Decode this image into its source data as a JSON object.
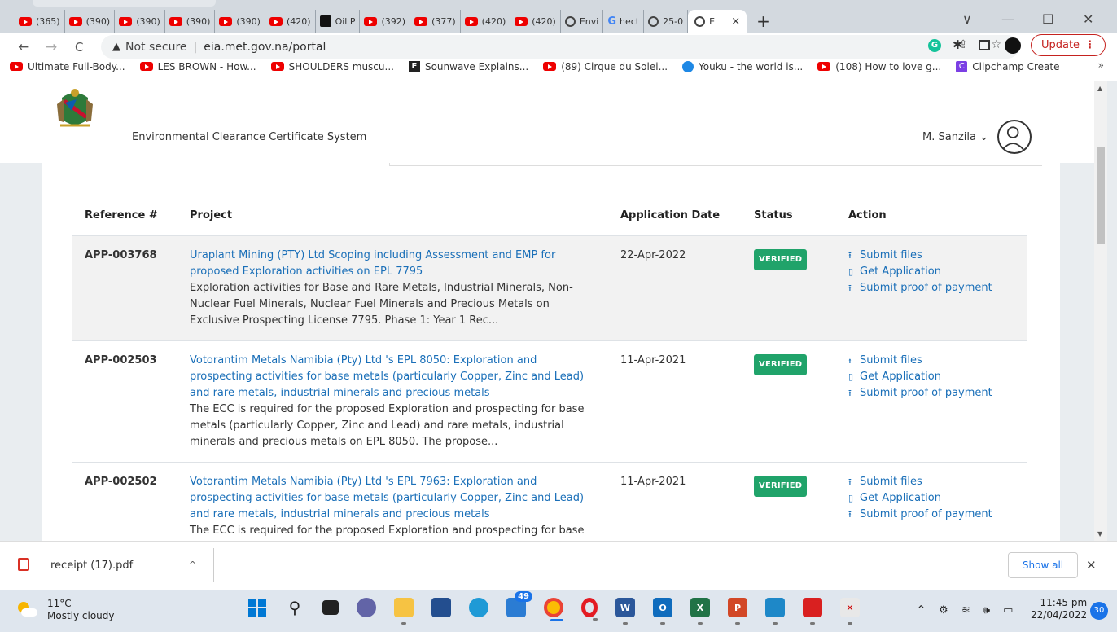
{
  "browser": {
    "tabs": [
      {
        "label": "(365)",
        "icon": "youtube-icon"
      },
      {
        "label": "(390)",
        "icon": "youtube-icon"
      },
      {
        "label": "(390)",
        "icon": "youtube-icon"
      },
      {
        "label": "(390)",
        "icon": "youtube-icon"
      },
      {
        "label": "(390)",
        "icon": "youtube-icon"
      },
      {
        "label": "(420)",
        "icon": "youtube-icon"
      },
      {
        "label": "Oil P",
        "icon": "dark-square-icon"
      },
      {
        "label": "(392)",
        "icon": "youtube-icon"
      },
      {
        "label": "(377)",
        "icon": "youtube-icon"
      },
      {
        "label": "(420)",
        "icon": "youtube-icon"
      },
      {
        "label": "(420)",
        "icon": "youtube-icon"
      },
      {
        "label": "Envi",
        "icon": "globe-icon"
      },
      {
        "label": "hect",
        "icon": "google-icon"
      },
      {
        "label": "25-0",
        "icon": "globe-icon"
      }
    ],
    "active_tab": {
      "label": "E",
      "close": "×"
    },
    "new_tab": "+",
    "window_controls": {
      "dropdown": "∨",
      "minimize": "—",
      "maximize": "☐",
      "close": "✕"
    },
    "nav": {
      "back": "←",
      "forward": "→",
      "reload": "C"
    },
    "address": {
      "warning_icon": "▲",
      "not_secure": "Not secure",
      "separator": "|",
      "url": "eia.met.gov.na/portal"
    },
    "omni_icons": "⇪ ☆",
    "extension_g": "G",
    "update": {
      "label": "Update",
      "dots": "⋮"
    },
    "bookmarks": [
      {
        "label": "Ultimate Full-Body...",
        "icon": "youtube-icon"
      },
      {
        "label": "LES BROWN - How...",
        "icon": "youtube-icon"
      },
      {
        "label": "SHOULDERS muscu...",
        "icon": "youtube-icon"
      },
      {
        "label": "Sounwave Explains...",
        "icon": "f-square-icon",
        "glyph": "F"
      },
      {
        "label": "(89) Cirque du Solei...",
        "icon": "youtube-icon"
      },
      {
        "label": "Youku - the world is...",
        "icon": "youku-icon"
      },
      {
        "label": "(108) How to love g...",
        "icon": "youtube-icon"
      },
      {
        "label": "Clipchamp Create",
        "icon": "clipchamp-icon",
        "glyph": "C"
      }
    ],
    "bookmarks_more": "»"
  },
  "app": {
    "title": "Environmental Clearance Certificate System",
    "user": "M. Sanzila ⌄"
  },
  "table": {
    "headers": [
      "Reference #",
      "Project",
      "Application Date",
      "Status",
      "Action"
    ],
    "rows": [
      {
        "ref": "APP-003768",
        "project_link": "Uraplant Mining (PTY) Ltd Scoping including Assessment and EMP for proposed Exploration activities on EPL 7795",
        "project_desc": "Exploration activities for Base and Rare Metals, Industrial Minerals, Non-Nuclear Fuel Minerals, Nuclear Fuel Minerals and Precious Metals on Exclusive Prospecting License 7795. Phase 1: Year 1 Rec...",
        "date": "22-Apr-2022",
        "status": "VERIFIED"
      },
      {
        "ref": "APP-002503",
        "project_link": "Votorantim Metals Namibia (Pty) Ltd 's EPL 8050: Exploration and prospecting activities for base metals (particularly Copper, Zinc and Lead) and rare metals, industrial minerals and precious metals",
        "project_desc": "The ECC is required for the proposed Exploration and prospecting for base metals (particularly Copper, Zinc and Lead) and rare metals, industrial minerals and precious metals on EPL 8050. The propose...",
        "date": "11-Apr-2021",
        "status": "VERIFIED"
      },
      {
        "ref": "APP-002502",
        "project_link": "Votorantim Metals Namibia (Pty) Ltd 's EPL 7963: Exploration and prospecting activities for base metals (particularly Copper, Zinc and Lead) and rare metals, industrial minerals and precious metals",
        "project_desc": "The ECC is required for the proposed Exploration and prospecting for base",
        "date": "11-Apr-2021",
        "status": "VERIFIED"
      }
    ],
    "actions": {
      "submit_files": "Submit files",
      "get_application": "Get Application",
      "submit_payment": "Submit proof of payment"
    }
  },
  "downloads": {
    "file": "receipt (17).pdf",
    "chevron": "^",
    "show_all": "Show all",
    "close": "✕"
  },
  "taskbar": {
    "temp": "11°C",
    "condition": "Mostly cloudy",
    "mail_badge": "49",
    "tray": "^ ⚙ ≋ 🕪 ▭",
    "time": "11:45 pm",
    "date": "22/04/2022",
    "notifications": "30"
  },
  "colors": {
    "link": "#1a6fb8",
    "verified": "#20a36a",
    "update_red": "#c5221f",
    "youtube_red": "#ee0000"
  }
}
